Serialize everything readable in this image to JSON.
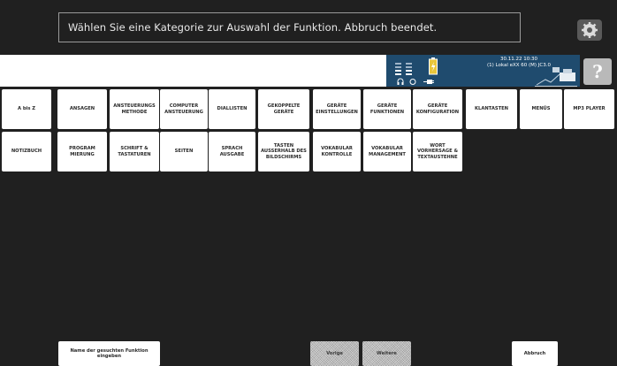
{
  "header": {
    "prompt": "Wählen Sie eine Kategorie zur Auswahl der Funktion. Abbruch beendet."
  },
  "status": {
    "datetime": "30.11.22 10:30",
    "device": "(1) Lokal eXX 60 (M) JC3.0"
  },
  "help_label": "?",
  "icons": {
    "settings": "settings-icon",
    "signal": "signal-bars-icon",
    "battery": "battery-icon",
    "headphones": "headphones-icon",
    "plug": "plug-icon",
    "printer": "printer-icon"
  },
  "categories_row1": [
    "A bis Z",
    "ANSAGEN",
    "ANSTEUERUNGS METHODE",
    "COMPUTER ANSTEUERUNG",
    "DIALLISTEN",
    "GEKOPPELTE GERÄTE",
    "GERÄTE EINSTELLUNGEN",
    "GERÄTE FUNKTIONEN",
    "GERÄTE KONFIGURATION",
    "KLANTASTEN",
    "MENÜS",
    "MP3 PLAYER"
  ],
  "categories_row2": [
    "NOTIZBUCH",
    "PROGRAM MIERUNG",
    "SCHRIFT & TASTATUREN",
    "SEITEN",
    "SPRACH AUSGABE",
    "TASTEN AUSSERHALB DES BILDSCHIRMS",
    "VOKABULAR KONTROLLE",
    "VOKABULAR MANAGEMENT",
    "WORT VORHERSAGE & TEXTAUSTEHNE"
  ],
  "bottom": {
    "search_label": "Name der gesuchten Funktion eingeben",
    "prev_label": "Vorige",
    "next_label": "Weitere",
    "cancel_label": "Abbruch"
  },
  "colors": {
    "background": "#202020",
    "status_panel": "#1f4b6e",
    "button": "#ffffff"
  }
}
